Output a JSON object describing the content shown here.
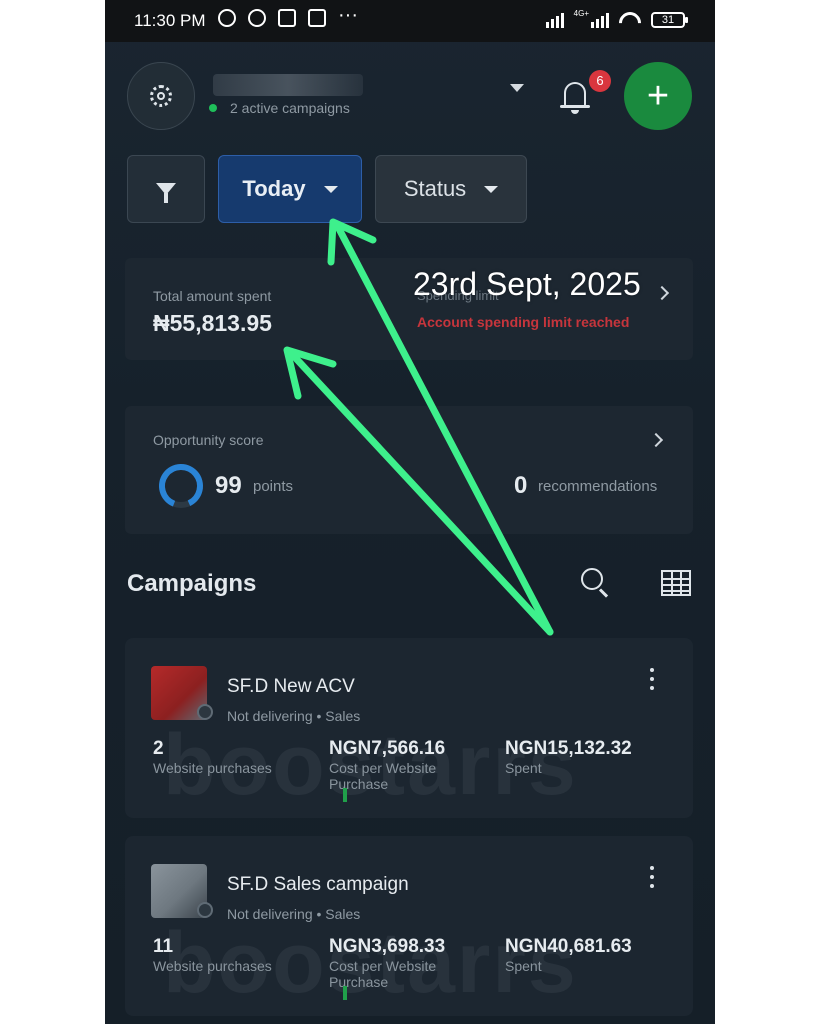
{
  "status_bar": {
    "time": "11:30 PM",
    "network_label": "4G+",
    "battery": "31",
    "left_icons": [
      "alarm-icon",
      "whatsapp-icon",
      "usb-icon",
      "gallery-icon",
      "more-dots-icon"
    ],
    "more_glyph": "···"
  },
  "header": {
    "active_campaigns": "2 active campaigns",
    "notification_count": "6",
    "add_glyph": "+"
  },
  "filters": {
    "date_label": "Today",
    "status_label": "Status"
  },
  "spend": {
    "total_label": "Total amount spent",
    "total_value": "₦55,813.95",
    "limit_label": "Spending limit",
    "limit_status": "Account spending limit reached"
  },
  "annotation": {
    "date_text": "23rd Sept, 2025",
    "arrow_color": "#3ef08c"
  },
  "opportunity": {
    "label": "Opportunity score",
    "score": "99",
    "score_unit": "points",
    "score_fraction": 0.99,
    "recommendations": "0",
    "recommendations_unit": "recommendations"
  },
  "campaigns": {
    "title": "Campaigns",
    "watermark": "boostarrs",
    "items": [
      {
        "name": "SF.D New ACV",
        "status": "Not delivering • Sales",
        "result_value": "2",
        "result_label": "Website purchases",
        "cost_value": "NGN7,566.16",
        "cost_label": "Cost per Website Purchase",
        "spent_value": "NGN15,132.32",
        "spent_label": "Spent"
      },
      {
        "name": "SF.D Sales campaign",
        "status": "Not delivering • Sales",
        "result_value": "11",
        "result_label": "Website purchases",
        "cost_value": "NGN3,698.33",
        "cost_label": "Cost per Website Purchase",
        "spent_value": "NGN40,681.63",
        "spent_label": "Spent"
      }
    ]
  },
  "colors": {
    "background": "#16212b",
    "card": "#1d2731",
    "accent_blue": "#163a6e",
    "add_green": "#1a8a3e",
    "alert_red": "#c6353c",
    "badge_red": "#d9363e"
  }
}
